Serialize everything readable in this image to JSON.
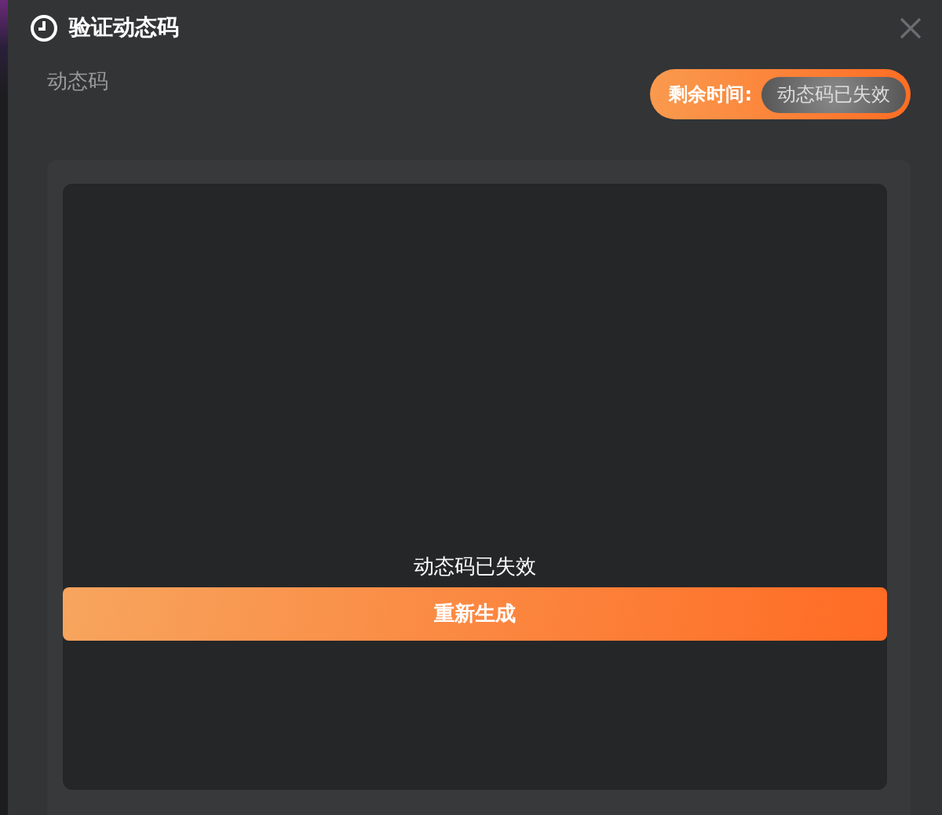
{
  "dialog": {
    "title": "验证动态码",
    "field_label": "动态码",
    "timer": {
      "label": "剩余时间:",
      "value": "动态码已失效"
    },
    "code_area": {
      "status": "动态码已失效",
      "button": "重新生成"
    }
  }
}
